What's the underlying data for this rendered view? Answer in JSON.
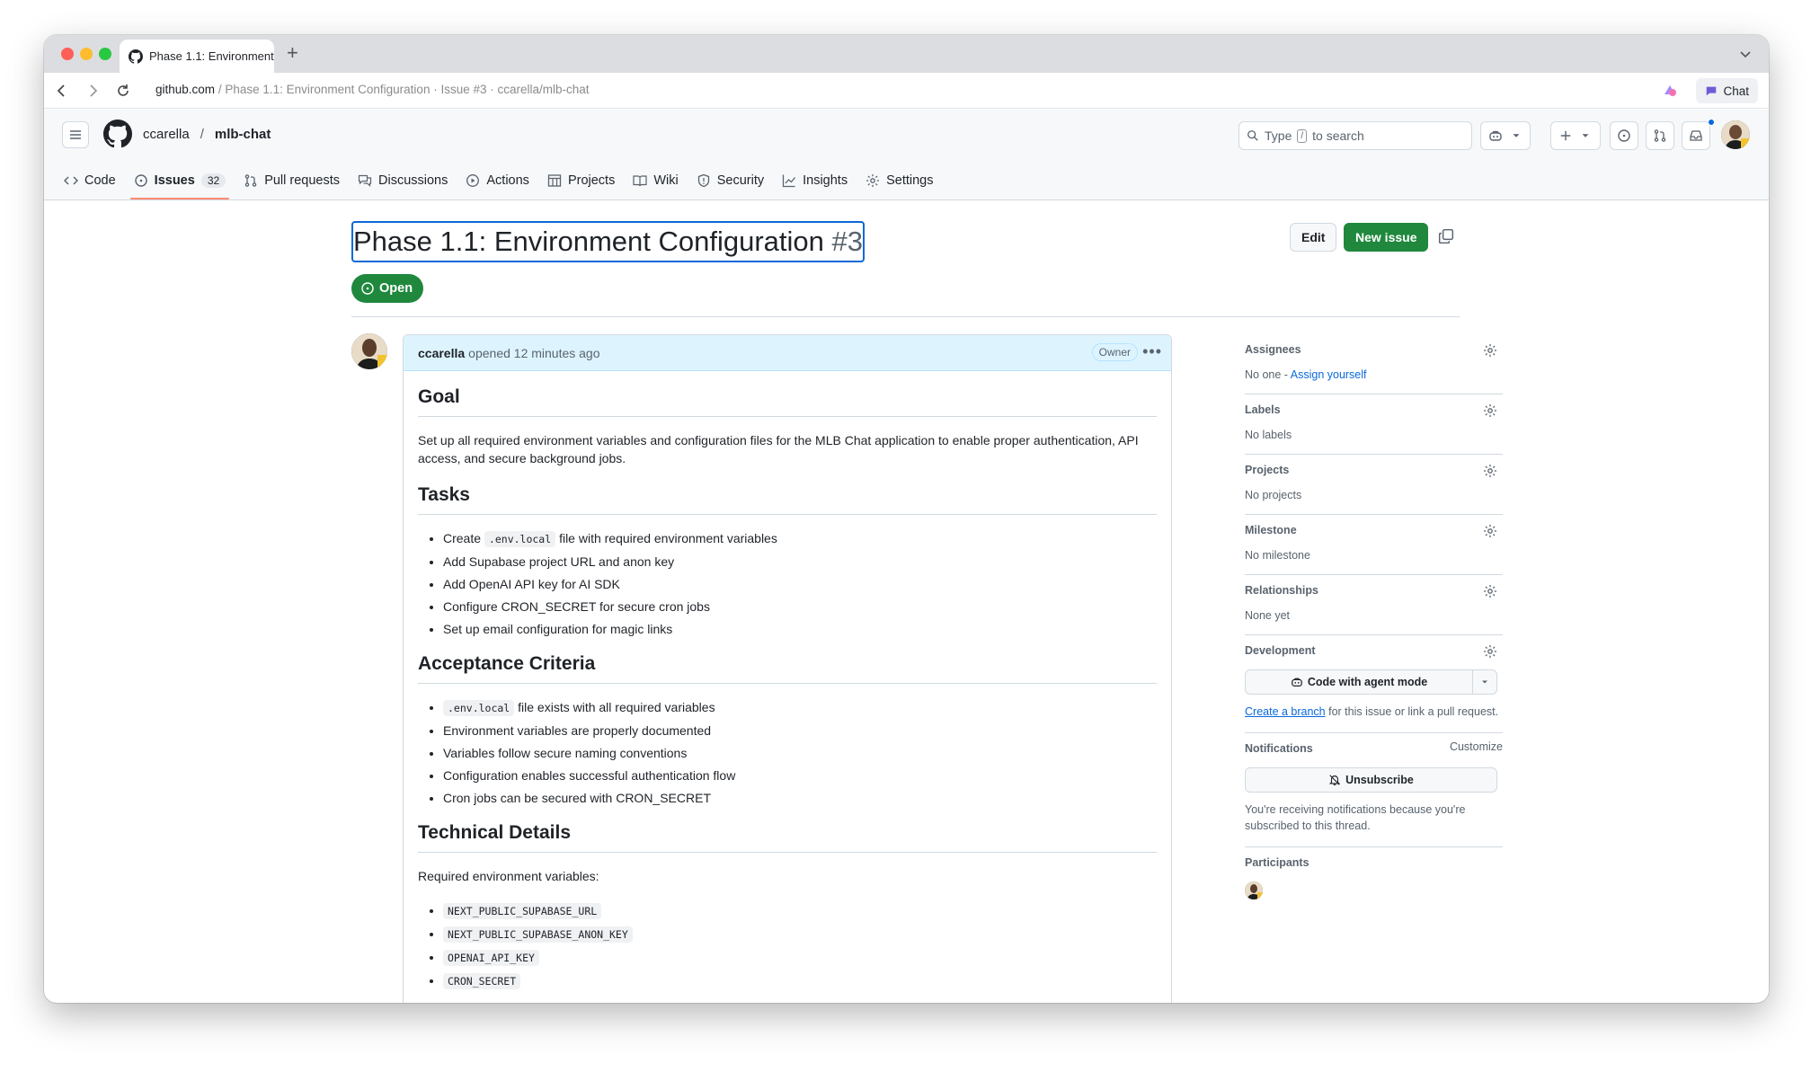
{
  "browser": {
    "tab_title": "Phase 1.1: Environment",
    "url_host": "github.com",
    "url_rest": "/ Phase 1.1: Environment Configuration · Issue #3 · ccarella/mlb-chat",
    "chat_label": "Chat"
  },
  "header": {
    "owner": "ccarella",
    "separator": "/",
    "repo": "mlb-chat",
    "search_prefix": "Type",
    "search_key": "/",
    "search_suffix": "to search"
  },
  "repo_nav": [
    {
      "label": "Code",
      "icon": "code-icon"
    },
    {
      "label": "Issues",
      "icon": "issue-icon",
      "count": "32",
      "active": true
    },
    {
      "label": "Pull requests",
      "icon": "pull-request-icon"
    },
    {
      "label": "Discussions",
      "icon": "discussion-icon"
    },
    {
      "label": "Actions",
      "icon": "play-icon"
    },
    {
      "label": "Projects",
      "icon": "table-icon"
    },
    {
      "label": "Wiki",
      "icon": "book-icon"
    },
    {
      "label": "Security",
      "icon": "shield-icon"
    },
    {
      "label": "Insights",
      "icon": "graph-icon"
    },
    {
      "label": "Settings",
      "icon": "gear-icon"
    }
  ],
  "issue": {
    "title": "Phase 1.1: Environment Configuration",
    "number": "#3",
    "state": "Open",
    "edit_label": "Edit",
    "new_issue_label": "New issue"
  },
  "comment": {
    "author": "ccarella",
    "meta": "opened 12 minutes ago",
    "badge": "Owner",
    "goal_heading": "Goal",
    "goal_text": "Set up all required environment variables and configuration files for the MLB Chat application to enable proper authentication, API access, and secure background jobs.",
    "tasks_heading": "Tasks",
    "task1_pre": "Create",
    "task1_code": ".env.local",
    "task1_post": "file with required environment variables",
    "task2": "Add Supabase project URL and anon key",
    "task3": "Add OpenAI API key for AI SDK",
    "task4": "Configure CRON_SECRET for secure cron jobs",
    "task5": "Set up email configuration for magic links",
    "criteria_heading": "Acceptance Criteria",
    "crit1_code": ".env.local",
    "crit1_post": "file exists with all required variables",
    "crit2": "Environment variables are properly documented",
    "crit3": "Variables follow secure naming conventions",
    "crit4": "Configuration enables successful authentication flow",
    "crit5": "Cron jobs can be secured with CRON_SECRET",
    "tech_heading": "Technical Details",
    "tech_intro": "Required environment variables:",
    "var1": "NEXT_PUBLIC_SUPABASE_URL",
    "var2": "NEXT_PUBLIC_SUPABASE_ANON_KEY",
    "var3": "OPENAI_API_KEY",
    "var4": "CRON_SECRET"
  },
  "sidebar": {
    "assignees_title": "Assignees",
    "assignees_none": "No one -",
    "assign_yourself": "Assign yourself",
    "labels_title": "Labels",
    "labels_value": "No labels",
    "projects_title": "Projects",
    "projects_value": "No projects",
    "milestone_title": "Milestone",
    "milestone_value": "No milestone",
    "relationships_title": "Relationships",
    "relationships_value": "None yet",
    "development_title": "Development",
    "agent_button": "Code with agent mode",
    "create_branch": "Create a branch",
    "development_note": "for this issue or link a pull request.",
    "notifications_title": "Notifications",
    "customize": "Customize",
    "unsubscribe": "Unsubscribe",
    "notifications_note": "You're receiving notifications because you're subscribed to this thread.",
    "participants_title": "Participants"
  }
}
